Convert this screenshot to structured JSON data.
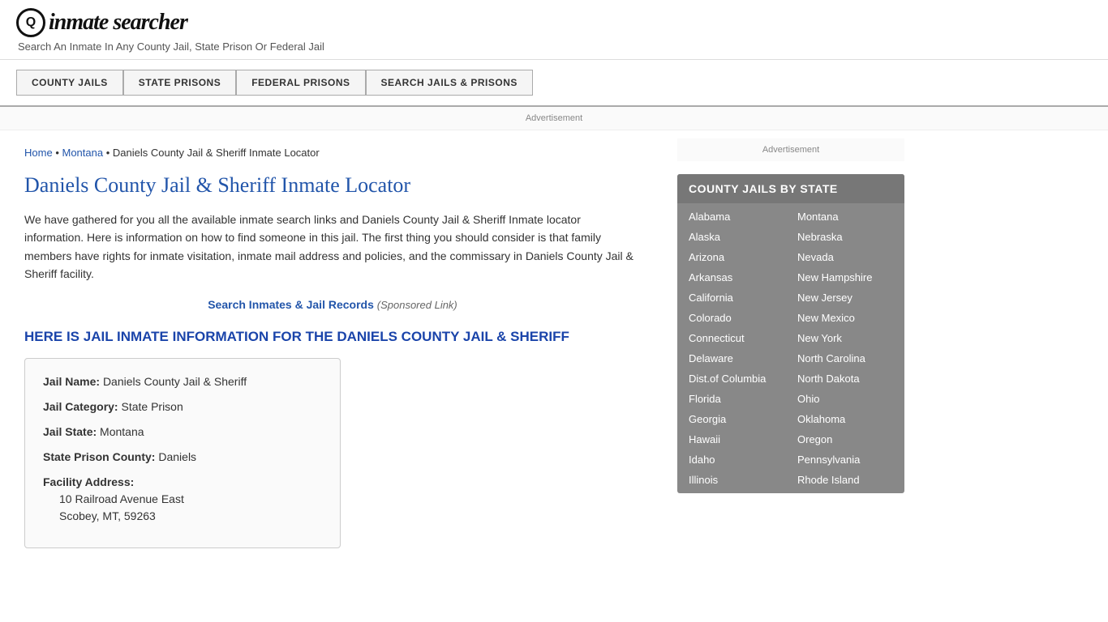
{
  "logo": {
    "icon_symbol": "Q",
    "text": "inmate searcher",
    "tagline": "Search An Inmate In Any County Jail, State Prison Or Federal Jail"
  },
  "nav": {
    "items": [
      {
        "label": "COUNTY JAILS",
        "name": "county-jails-nav"
      },
      {
        "label": "STATE PRISONS",
        "name": "state-prisons-nav"
      },
      {
        "label": "FEDERAL PRISONS",
        "name": "federal-prisons-nav"
      },
      {
        "label": "SEARCH JAILS & PRISONS",
        "name": "search-jails-nav"
      }
    ]
  },
  "ad": {
    "banner_label": "Advertisement",
    "sidebar_label": "Advertisement"
  },
  "breadcrumb": {
    "home": "Home",
    "state": "Montana",
    "current": "Daniels County Jail & Sheriff Inmate Locator"
  },
  "page_title": "Daniels County Jail & Sheriff Inmate Locator",
  "description": "We have gathered for you all the available inmate search links and Daniels County Jail & Sheriff Inmate locator information. Here is information on how to find someone in this jail. The first thing you should consider is that family members have rights for inmate visitation, inmate mail address and policies, and the commissary in Daniels County Jail & Sheriff facility.",
  "search_link": {
    "text": "Search Inmates & Jail Records",
    "sponsored": "(Sponsored Link)"
  },
  "section_heading": "HERE IS JAIL INMATE INFORMATION FOR THE DANIELS COUNTY JAIL & SHERIFF",
  "info_card": {
    "jail_name_label": "Jail Name:",
    "jail_name_value": "Daniels County Jail & Sheriff",
    "jail_category_label": "Jail Category:",
    "jail_category_value": "State Prison",
    "jail_state_label": "Jail State:",
    "jail_state_value": "Montana",
    "state_prison_county_label": "State Prison County:",
    "state_prison_county_value": "Daniels",
    "facility_address_label": "Facility Address:",
    "address_line1": "10 Railroad Avenue East",
    "address_line2": "Scobey, MT, 59263"
  },
  "sidebar": {
    "county_jails_header": "COUNTY JAILS BY STATE",
    "states_left": [
      "Alabama",
      "Alaska",
      "Arizona",
      "Arkansas",
      "California",
      "Colorado",
      "Connecticut",
      "Delaware",
      "Dist.of Columbia",
      "Florida",
      "Georgia",
      "Hawaii",
      "Idaho",
      "Illinois"
    ],
    "states_right": [
      "Montana",
      "Nebraska",
      "Nevada",
      "New Hampshire",
      "New Jersey",
      "New Mexico",
      "New York",
      "North Carolina",
      "North Dakota",
      "Ohio",
      "Oklahoma",
      "Oregon",
      "Pennsylvania",
      "Rhode Island"
    ]
  }
}
